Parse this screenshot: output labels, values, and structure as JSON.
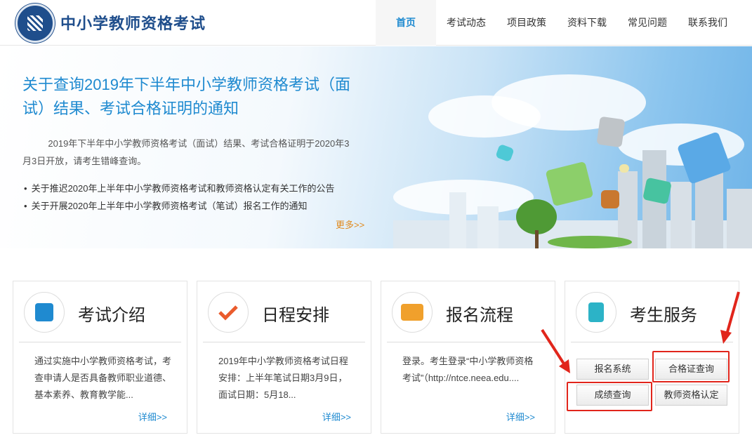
{
  "header": {
    "site_title": "中小学教师资格考试",
    "nav": [
      "首页",
      "考试动态",
      "项目政策",
      "资料下载",
      "常见问题",
      "联系我们"
    ],
    "active_nav": "首页"
  },
  "banner": {
    "title": "关于查询2019年下半年中小学教师资格考试（面试）结果、考试合格证明的通知",
    "description": "2019年下半年中小学教师资格考试（面试）结果、考试合格证明于2020年3月3日开放，请考生错峰查询。",
    "news": [
      "关于推迟2020年上半年中小学教师资格考试和教师资格认定有关工作的公告",
      "关于开展2020年上半年中小学教师资格考试（笔试）报名工作的通知"
    ],
    "more": "更多>>"
  },
  "cards": [
    {
      "title": "考试介绍",
      "icon": "document-edit-icon",
      "text": "通过实施中小学教师资格考试，考查申请人是否具备教师职业道德、基本素养、教育教学能...",
      "more": "详细>>"
    },
    {
      "title": "日程安排",
      "icon": "checkmark-icon",
      "text": "2019年中小学教师资格考试日程安排：上半年笔试日期3月9日，面试日期：5月18...",
      "more": "详细>>"
    },
    {
      "title": "报名流程",
      "icon": "form-window-icon",
      "text": "登录。考生登录“中小学教师资格考试”（http://ntce.neea.edu....",
      "more": "详细>>"
    },
    {
      "title": "考生服务",
      "icon": "contact-book-icon"
    }
  ],
  "services": [
    "报名系统",
    "合格证查询",
    "成绩查询",
    "教师资格认定"
  ],
  "colors": {
    "brand": "#1f4e8c",
    "link": "#1f8ad0",
    "more": "#e08a1e",
    "highlight": "#e1251b"
  }
}
